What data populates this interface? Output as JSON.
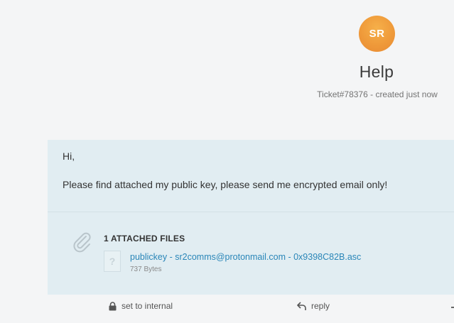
{
  "header": {
    "avatar_initials": "SR",
    "avatar_color": "#ef9a3a",
    "title": "Help",
    "subtitle": "Ticket#78376 - created just now"
  },
  "article": {
    "background": "#e1edf2",
    "greeting": "Hi,",
    "body": "Please find attached my public key, please send me encrypted email only!",
    "attachments": {
      "heading": "1 ATTACHED FILES",
      "icon": "paperclip-icon",
      "files": [
        {
          "name": "publickey - sr2comms@protonmail.com - 0x9398C82B.asc",
          "size": "737 Bytes",
          "icon": "unknown-file-icon",
          "link_color": "#2a86b8"
        }
      ]
    }
  },
  "actions": {
    "set_internal": {
      "label": "set to internal",
      "icon": "lock-icon"
    },
    "reply": {
      "label": "reply",
      "icon": "reply-arrow-icon"
    }
  }
}
